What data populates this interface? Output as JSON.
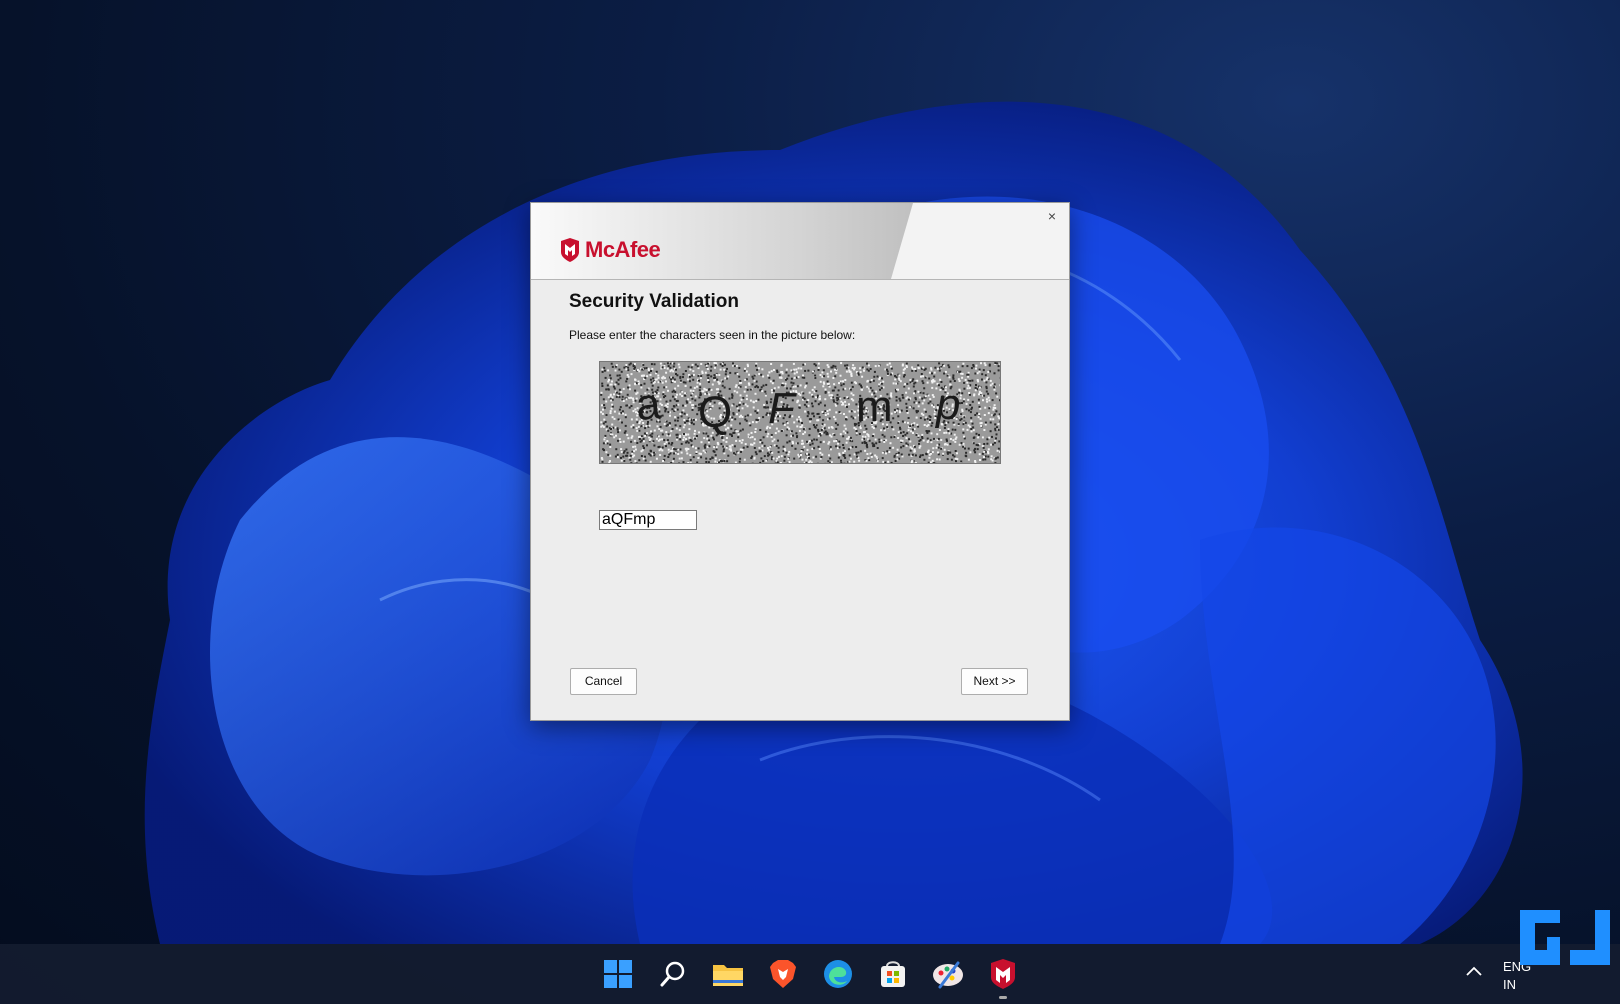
{
  "dialog": {
    "brand": "McAfee",
    "title": "Security Validation",
    "instruction": "Please enter the characters seen in the picture below:",
    "captcha_chars": [
      "a",
      "Q",
      "F",
      "m",
      "p"
    ],
    "input_value": "aQFmp",
    "cancel_label": "Cancel",
    "next_label": "Next >>",
    "close_glyph": "×"
  },
  "taskbar": {
    "icons": [
      "windows-start-icon",
      "search-icon",
      "file-explorer-icon",
      "brave-browser-icon",
      "edge-browser-icon",
      "microsoft-store-icon",
      "paint-app-icon",
      "mcafee-app-icon"
    ],
    "language_line1": "ENG",
    "language_line2": "IN"
  },
  "colors": {
    "brand_red": "#c8102e",
    "dialog_bg": "#ededed",
    "taskbar_bg": "#141c30"
  }
}
